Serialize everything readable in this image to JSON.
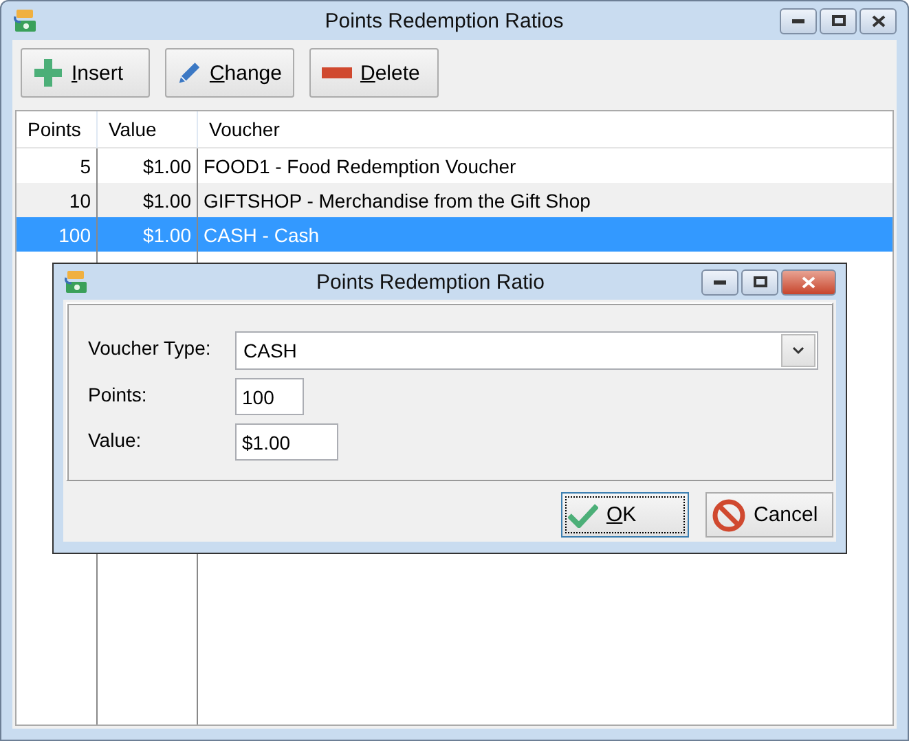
{
  "window": {
    "title": "Points Redemption Ratios"
  },
  "toolbar": [
    {
      "label": "Insert",
      "kind": "insert"
    },
    {
      "label": "Change",
      "kind": "change"
    },
    {
      "label": "Delete",
      "kind": "delete"
    }
  ],
  "table": {
    "columns": [
      "Points",
      "Value",
      "Voucher"
    ],
    "rows": [
      {
        "points": "5",
        "value": "$1.00",
        "voucher": "FOOD1 - Food Redemption Voucher",
        "selected": false
      },
      {
        "points": "10",
        "value": "$1.00",
        "voucher": "GIFTSHOP - Merchandise from the Gift Shop",
        "selected": false
      },
      {
        "points": "100",
        "value": "$1.00",
        "voucher": "CASH - Cash",
        "selected": true
      }
    ]
  },
  "dialog": {
    "title": "Points Redemption Ratio",
    "fields": [
      {
        "label": "Voucher Type:",
        "value": "CASH",
        "kind": "dropdown"
      },
      {
        "label": "Points:",
        "value": "100",
        "kind": "short"
      },
      {
        "label": "Value:",
        "value": "$1.00",
        "kind": "medium"
      }
    ],
    "buttons": [
      {
        "label": "OK",
        "kind": "ok",
        "focused": true
      },
      {
        "label": "Cancel",
        "kind": "cancel",
        "focused": false
      }
    ]
  }
}
